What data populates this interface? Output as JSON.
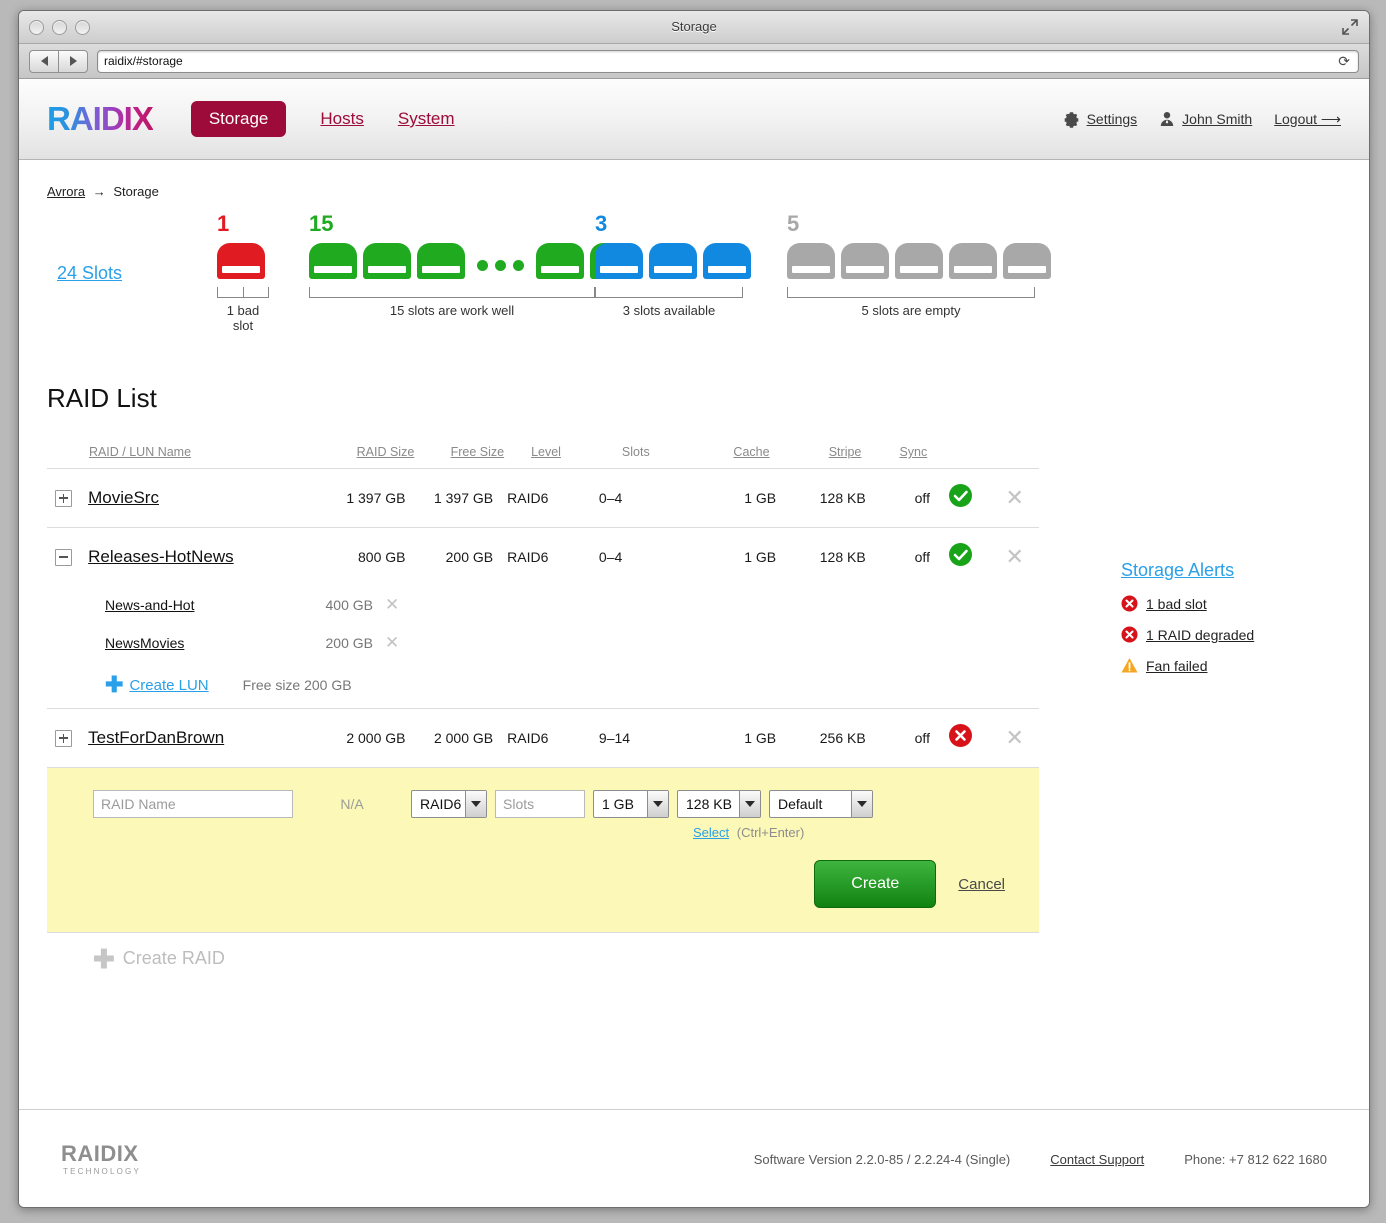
{
  "window": {
    "title": "Storage",
    "url": "raidix/#storage",
    "back_icon": "back-arrow-icon",
    "forward_icon": "forward-arrow-icon",
    "reload_icon": "reload-icon",
    "fullscreen_icon": "fullscreen-icon"
  },
  "header": {
    "logo": "RAIDIX",
    "nav": [
      {
        "label": "Storage",
        "active": true
      },
      {
        "label": "Hosts",
        "active": false
      },
      {
        "label": "System",
        "active": false
      }
    ],
    "settings": "Settings",
    "user": "John Smith",
    "logout": "Logout ⟶",
    "accent": "#9c0b3a"
  },
  "breadcrumb": {
    "root": "Avrora",
    "sep": "→",
    "current": "Storage"
  },
  "slots": {
    "total_label": "24 Slots",
    "groups": [
      {
        "count": "1",
        "caption": "1 bad slot",
        "color": "#e01b22",
        "disks": 1,
        "dots": false
      },
      {
        "count": "15",
        "caption": "15 slots are work well",
        "color": "#1faa1f",
        "disks": 5,
        "dots": true
      },
      {
        "count": "3",
        "caption": "3 slots available",
        "color": "#1189e0",
        "disks": 3,
        "dots": false
      },
      {
        "count": "5",
        "caption": "5 slots are empty",
        "color": "#a8a8a8",
        "disks": 5,
        "dots": false
      }
    ]
  },
  "raid_list": {
    "title": "RAID List",
    "columns": [
      {
        "label": "RAID / LUN Name",
        "underline": true
      },
      {
        "label": "RAID Size",
        "underline": true
      },
      {
        "label": "Free Size",
        "underline": true
      },
      {
        "label": "Level",
        "underline": true
      },
      {
        "label": "Slots",
        "underline": false
      },
      {
        "label": "Cache",
        "underline": true
      },
      {
        "label": "Stripe",
        "underline": true
      },
      {
        "label": "Sync",
        "underline": true
      }
    ],
    "rows": [
      {
        "toggle": "plus",
        "name": "MovieSrc",
        "raid_size": "1 397 GB",
        "free_size": "1 397 GB",
        "level": "RAID6",
        "slots": "0–4",
        "cache": "1 GB",
        "stripe": "128 KB",
        "sync": "off",
        "state": "ok"
      },
      {
        "toggle": "minus",
        "name": "Releases-HotNews",
        "raid_size": "800 GB",
        "free_size": "200 GB",
        "level": "RAID6",
        "slots": "0–4",
        "cache": "1 GB",
        "stripe": "128 KB",
        "sync": "off",
        "state": "ok",
        "luns": [
          {
            "name": "News-and-Hot",
            "size": "400 GB"
          },
          {
            "name": "NewsMovies",
            "size": "200 GB"
          }
        ],
        "create_lun": {
          "label": "Create LUN",
          "free": "Free size 200 GB"
        }
      },
      {
        "toggle": "plus",
        "name": "TestForDanBrown",
        "raid_size": "2 000 GB",
        "free_size": "2 000 GB",
        "level": "RAID6",
        "slots": "9–14",
        "cache": "1 GB",
        "stripe": "256 KB",
        "sync": "off",
        "state": "error"
      }
    ],
    "create_raid_label": "Create RAID"
  },
  "create_form": {
    "name_placeholder": "RAID Name",
    "name_value": "",
    "free_size": "N/A",
    "level": "RAID6",
    "slots_placeholder": "Slots",
    "slots_value": "",
    "cache": "1 GB",
    "stripe": "128 KB",
    "sync": "Default",
    "select_link": "Select",
    "select_hint": "(Ctrl+Enter)",
    "create_label": "Create",
    "cancel_label": "Cancel"
  },
  "alerts": {
    "title": "Storage Alerts",
    "items": [
      {
        "icon": "error-icon",
        "text": "1 bad slot"
      },
      {
        "icon": "error-icon",
        "text": "1 RAID degraded"
      },
      {
        "icon": "warning-icon",
        "text": "Fan failed"
      }
    ]
  },
  "footer": {
    "logo": "RAIDIX",
    "logo_sub": "TECHNOLOGY",
    "version": "Software Version 2.2.0-85 / 2.2.24-4 (Single)",
    "support": "Contact Support",
    "phone": "Phone: +7 812 622 1680"
  }
}
